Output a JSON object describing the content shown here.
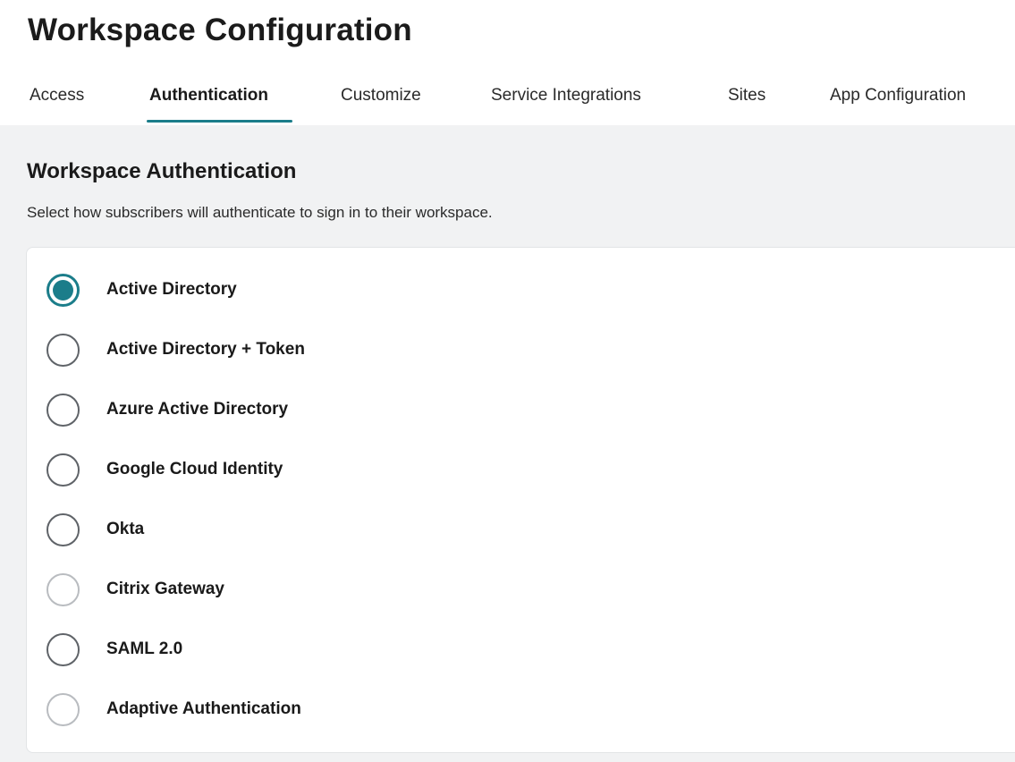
{
  "page": {
    "title": "Workspace Configuration"
  },
  "tabs": [
    {
      "label": "Access",
      "active": false
    },
    {
      "label": "Authentication",
      "active": true
    },
    {
      "label": "Customize",
      "active": false
    },
    {
      "label": "Service Integrations",
      "active": false
    },
    {
      "label": "Sites",
      "active": false
    },
    {
      "label": "App Configuration",
      "active": false
    }
  ],
  "section": {
    "title": "Workspace Authentication",
    "description": "Select how subscribers will authenticate to sign in to their workspace."
  },
  "options": [
    {
      "label": "Active Directory",
      "selected": true
    },
    {
      "label": "Active Directory + Token",
      "selected": false
    },
    {
      "label": "Azure Active Directory",
      "selected": false
    },
    {
      "label": "Google Cloud Identity",
      "selected": false
    },
    {
      "label": "Okta",
      "selected": false
    },
    {
      "label": "Citrix Gateway",
      "selected": false
    },
    {
      "label": "SAML 2.0",
      "selected": false
    },
    {
      "label": "Adaptive Authentication",
      "selected": false
    }
  ],
  "colors": {
    "accent": "#1b7d8a",
    "panel_background": "#f1f2f3"
  }
}
